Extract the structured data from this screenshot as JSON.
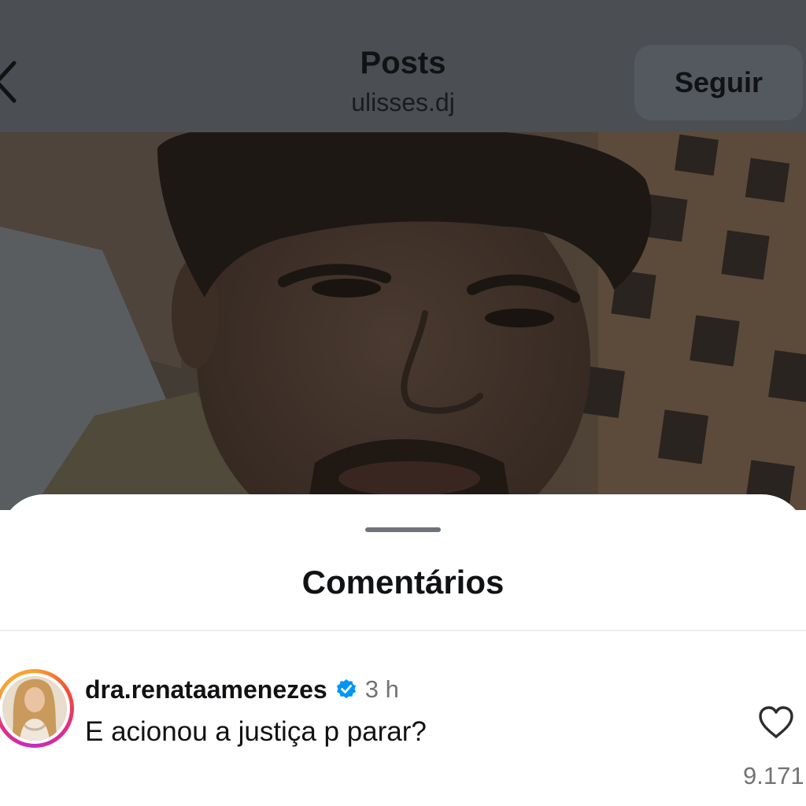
{
  "header": {
    "title": "Posts",
    "username": "ulisses.dj",
    "follow_label": "Seguir",
    "back_icon": "chevron-left-icon"
  },
  "post": {
    "image": "selfie-photo"
  },
  "comments_sheet": {
    "title": "Comentários",
    "comments": [
      {
        "username": "dra.renataamenezes",
        "verified": true,
        "time": "3 h",
        "text": "E acionou a justiça p parar?",
        "like_count": "9.171",
        "like_icon": "heart-outline-icon"
      }
    ]
  },
  "colors": {
    "dim_overlay": "#4b4e52",
    "follow_button_bg": "#54595f",
    "verified_badge": "#0095f6",
    "secondary_text": "#737373"
  }
}
